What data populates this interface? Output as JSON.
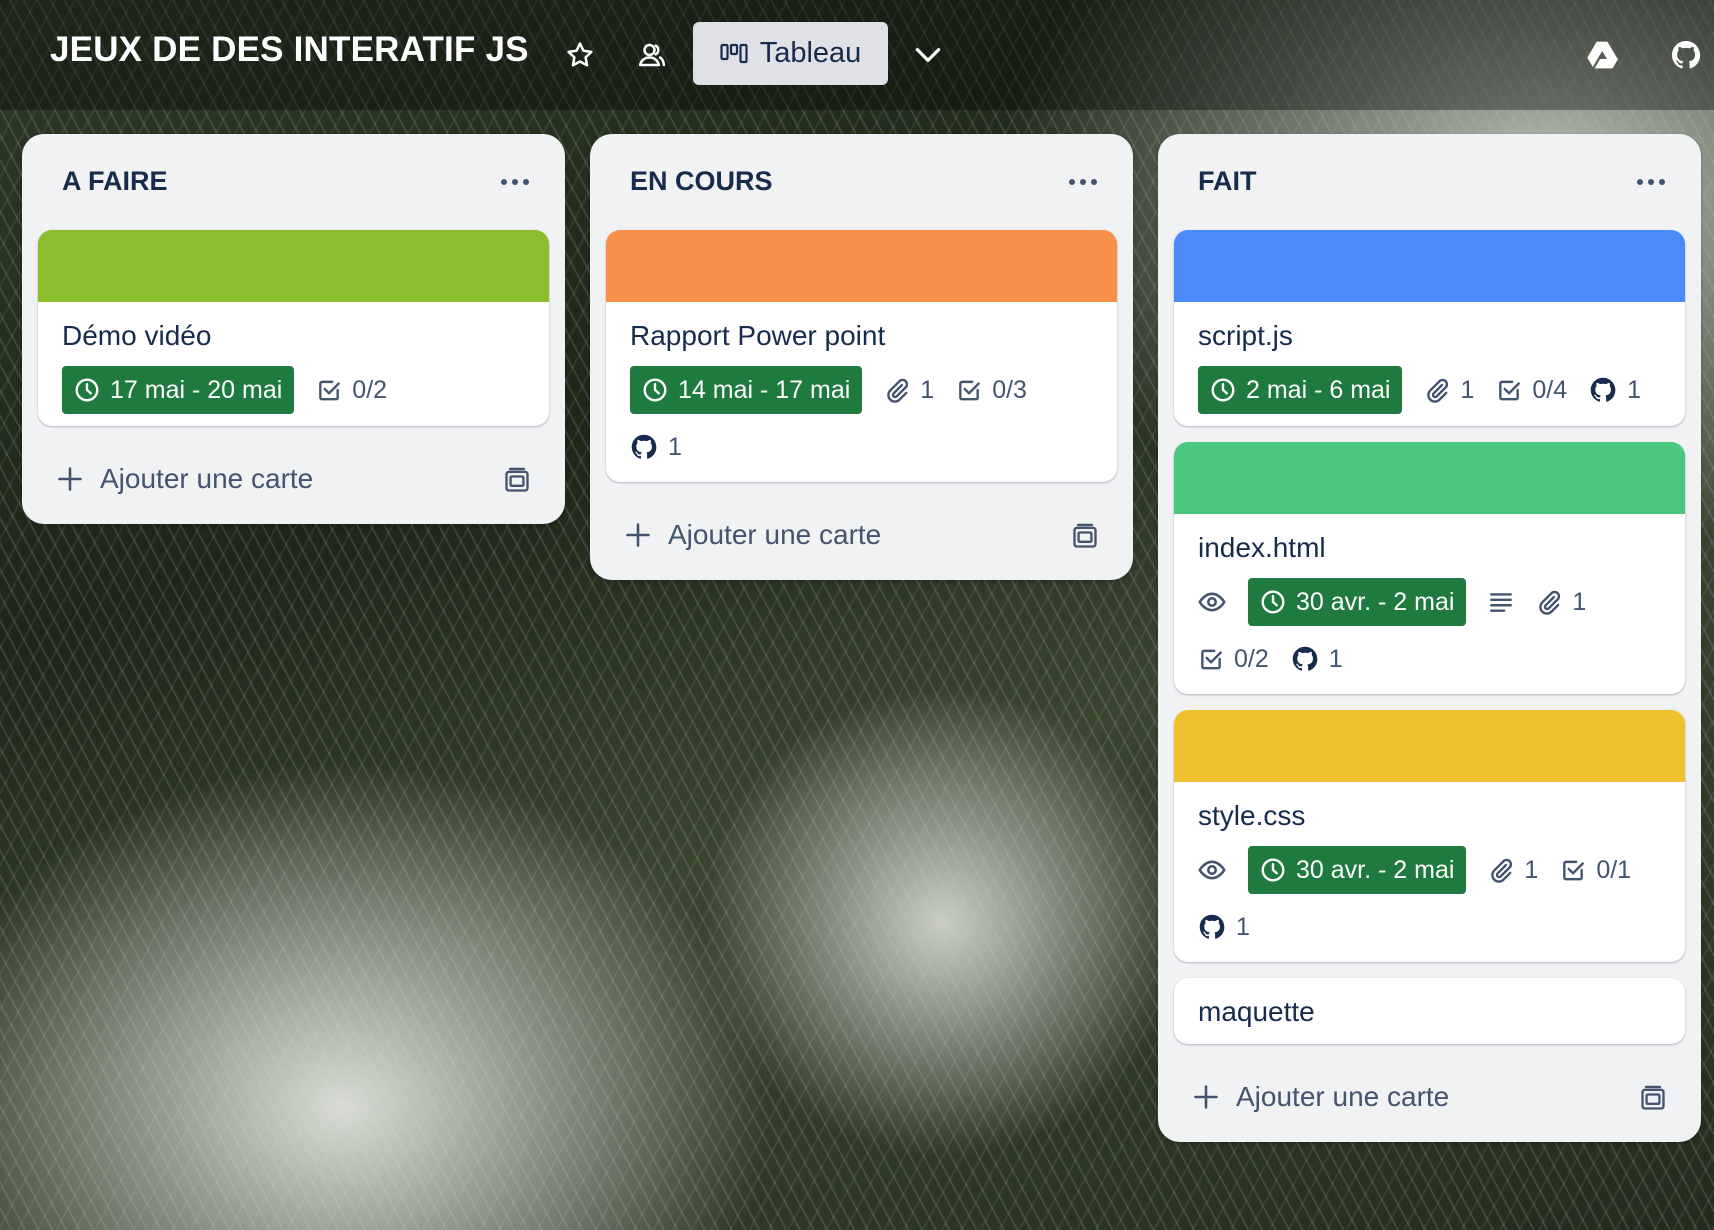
{
  "board": {
    "title": "JEUX DE DES INTERATIF JS",
    "view_label": "Tableau",
    "icons": [
      "star-icon",
      "workspace-visibility-icon",
      "board-view-icon",
      "chevron-down-icon",
      "google-drive-icon",
      "github-icon"
    ]
  },
  "colors": {
    "date_badge": "#1f7a3f",
    "cover_green": "#8bbd2f",
    "cover_orange": "#f88f4b",
    "cover_blue": "#4a8af9",
    "cover_teal": "#4bc780",
    "cover_yellow": "#f0c12f"
  },
  "add_card_label": "Ajouter une carte",
  "lists": [
    {
      "title": "A FAIRE",
      "cards": [
        {
          "title": "Démo vidéo",
          "date": "17 mai - 20 mai",
          "checklist": "0/2"
        }
      ]
    },
    {
      "title": "EN COURS",
      "cards": [
        {
          "title": "Rapport Power point",
          "date": "14 mai - 17 mai",
          "attachments": "1",
          "checklist": "0/3",
          "github": "1"
        }
      ]
    },
    {
      "title": "FAIT",
      "cards": [
        {
          "title": "script.js",
          "date": "2 mai - 6 mai",
          "attachments": "1",
          "checklist": "0/4",
          "github": "1"
        },
        {
          "title": "index.html",
          "date": "30 avr. - 2 mai",
          "attachments": "1",
          "checklist": "0/2",
          "github": "1"
        },
        {
          "title": "style.css",
          "date": "30 avr. - 2 mai",
          "attachments": "1",
          "checklist": "0/1",
          "github": "1"
        },
        {
          "title": "maquette"
        }
      ]
    }
  ]
}
